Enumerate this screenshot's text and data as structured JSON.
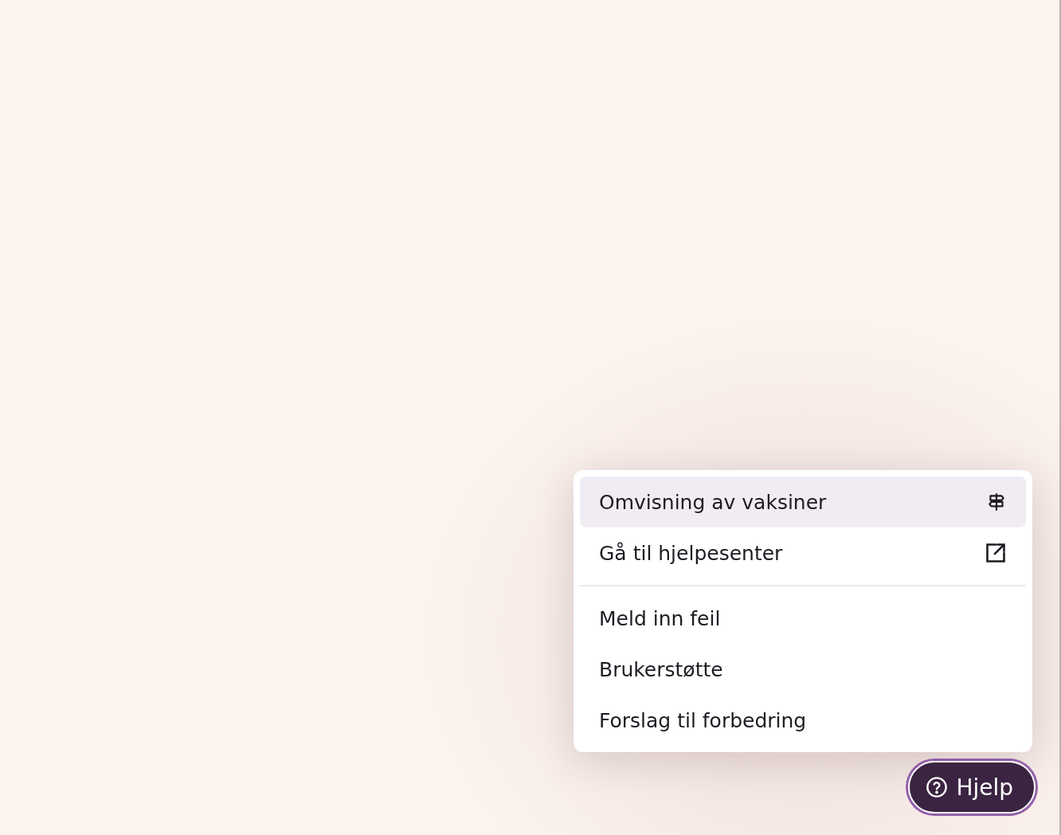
{
  "help_menu": {
    "groups": [
      {
        "items": [
          {
            "label": "Omvisning av vaksiner",
            "kind": "tour",
            "selected": true
          },
          {
            "label": "Gå til hjelpesenter",
            "kind": "external",
            "selected": false
          }
        ]
      },
      {
        "items": [
          {
            "label": "Meld inn feil",
            "kind": "plain",
            "selected": false
          },
          {
            "label": "Brukerstøtte",
            "kind": "plain",
            "selected": false
          },
          {
            "label": "Forslag til forbedring",
            "kind": "plain",
            "selected": false
          }
        ]
      }
    ]
  },
  "help_button": {
    "label": "Hjelp"
  }
}
